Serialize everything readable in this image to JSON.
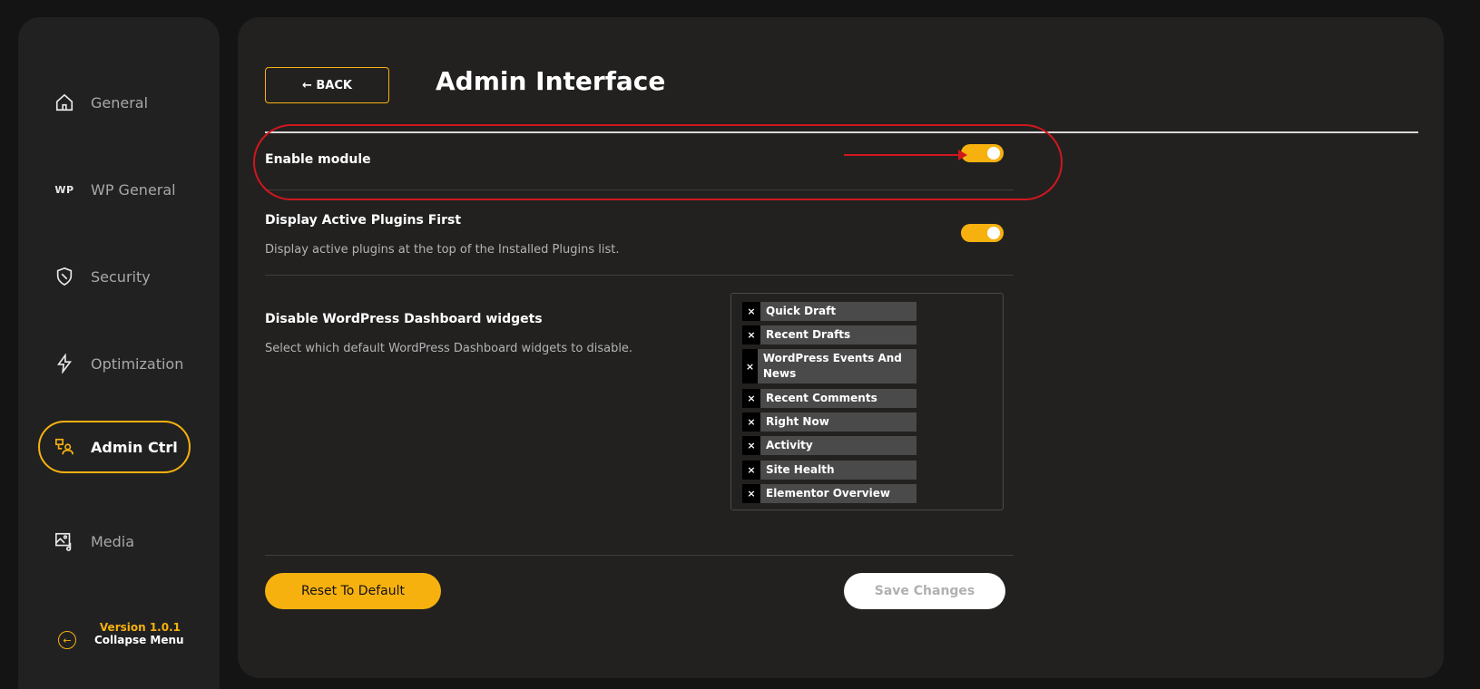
{
  "sidebar": {
    "items": [
      {
        "label": "General",
        "icon": "home-icon"
      },
      {
        "label": "WP General",
        "icon": "wp-icon",
        "icon_text": "WP"
      },
      {
        "label": "Security",
        "icon": "shield-icon"
      },
      {
        "label": "Optimization",
        "icon": "lightning-icon"
      },
      {
        "label": "Admin Ctrl",
        "icon": "admin-users-icon",
        "active": true
      },
      {
        "label": "Media",
        "icon": "media-icon"
      }
    ],
    "version": "Version 1.0.1",
    "collapse_label": "Collapse Menu"
  },
  "header": {
    "back_label": "← BACK",
    "title": "Admin Interface"
  },
  "settings": {
    "enable_module": {
      "label": "Enable module",
      "enabled": true
    },
    "display_active_plugins": {
      "label": "Display Active Plugins First",
      "description": "Display active plugins at the top of the Installed Plugins list.",
      "enabled": true
    },
    "disable_widgets": {
      "label": "Disable WordPress Dashboard widgets",
      "description": "Select which default WordPress Dashboard widgets to disable.",
      "selected": [
        "Quick Draft",
        "Recent Drafts",
        "WordPress Events And News",
        "Recent Comments",
        "Right Now",
        "Activity",
        "Site Health",
        "Elementor Overview"
      ]
    }
  },
  "footer": {
    "reset_label": "Reset To Default",
    "save_label": "Save Changes"
  },
  "colors": {
    "accent": "#f7b10f",
    "annotation": "#d0171e",
    "background": "#141414",
    "panel": "#222120"
  }
}
